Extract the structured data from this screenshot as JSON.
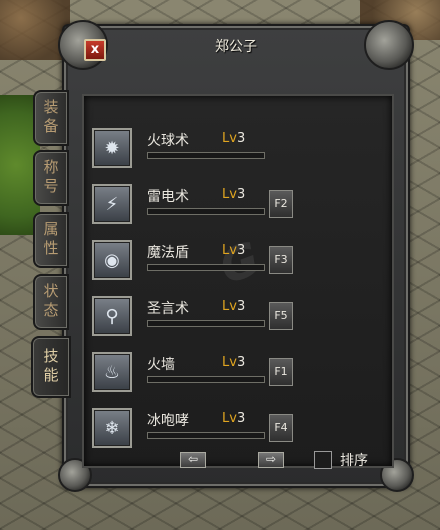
{
  "window": {
    "title": "郑公子",
    "close_label": "x"
  },
  "tabs": [
    {
      "label": "装备",
      "active": false
    },
    {
      "label": "称号",
      "active": false
    },
    {
      "label": "属性",
      "active": false
    },
    {
      "label": "状态",
      "active": false
    },
    {
      "label": "技能",
      "active": true
    }
  ],
  "skills": [
    {
      "name": "火球术",
      "level_prefix": "Lv",
      "level": "3",
      "hotkey": "",
      "icon": "fireball-icon",
      "progress": 0
    },
    {
      "name": "雷电术",
      "level_prefix": "Lv",
      "level": "3",
      "hotkey": "F2",
      "icon": "lightning-icon",
      "progress": 0
    },
    {
      "name": "魔法盾",
      "level_prefix": "Lv",
      "level": "3",
      "hotkey": "F3",
      "icon": "magic-shield-icon",
      "progress": 0
    },
    {
      "name": "圣言术",
      "level_prefix": "Lv",
      "level": "3",
      "hotkey": "F5",
      "icon": "holy-word-icon",
      "progress": 0
    },
    {
      "name": "火墙",
      "level_prefix": "Lv",
      "level": "3",
      "hotkey": "F1",
      "icon": "fire-wall-icon",
      "progress": 0
    },
    {
      "name": "冰咆哮",
      "level_prefix": "Lv",
      "level": "3",
      "hotkey": "F4",
      "icon": "ice-roar-icon",
      "progress": 0
    }
  ],
  "controls": {
    "prev_icon": "left-arrow-icon",
    "next_icon": "right-arrow-icon",
    "prev_label": "⇦",
    "next_label": "⇨",
    "sort_label": "排序",
    "sort_checked": false
  }
}
